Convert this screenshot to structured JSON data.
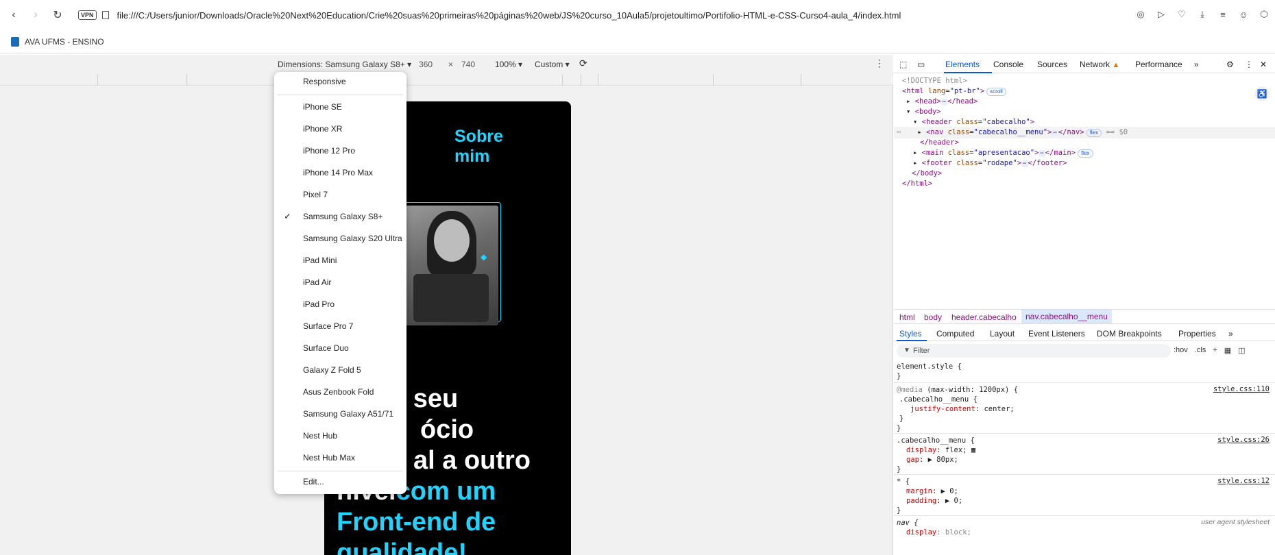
{
  "browser": {
    "url": "file:///C:/Users/junior/Downloads/Oracle%20Next%20Education/Crie%20suas%20primeiras%20páginas%20web/JS%20curso_10Aula5/projetoultimo/Portifolio-HTML-e-CSS-Curso4-aula_4/index.html",
    "vpn_label": "VPN",
    "bookmark_label": "AVA UFMS - ENSINO"
  },
  "device_toolbar": {
    "dimensions_label": "Dimensions: Samsung Galaxy S8+",
    "width": "360",
    "times": "×",
    "height": "740",
    "zoom": "100%",
    "throttle": "Custom"
  },
  "page": {
    "sobre_line1": "Sobre",
    "sobre_line2": "mim",
    "headline_line1": "e seu",
    "headline_line2": "ócio",
    "headline_line3": "al a outro",
    "headline_line4_white": "nível",
    "headline_line4_accent": "com um",
    "headline_line5": "Front-end de",
    "headline_line6": "qualidade!"
  },
  "device_menu": {
    "items": [
      "Responsive",
      "iPhone SE",
      "iPhone XR",
      "iPhone 12 Pro",
      "iPhone 14 Pro Max",
      "Pixel 7",
      "Samsung Galaxy S8+",
      "Samsung Galaxy S20 Ultra",
      "iPad Mini",
      "iPad Air",
      "iPad Pro",
      "Surface Pro 7",
      "Surface Duo",
      "Galaxy Z Fold 5",
      "Asus Zenbook Fold",
      "Samsung Galaxy A51/71",
      "Nest Hub",
      "Nest Hub Max",
      "Edit..."
    ],
    "selected": "Samsung Galaxy S8+",
    "check_glyph": "✓"
  },
  "devtools": {
    "tabs": [
      "Elements",
      "Console",
      "Sources",
      "Network",
      "Performance"
    ],
    "active_tab": "Elements",
    "dom": {
      "doctype": "<!DOCTYPE html>",
      "html_open_tag": "<html",
      "html_lang_attr": "lang",
      "html_lang_val": "\"pt-br\"",
      "scroll_badge": "scroll",
      "head": "<head>",
      "head_close": "</head>",
      "body_open": "<body>",
      "header_tag": "<header",
      "header_class_val": "\"cabecalho\"",
      "nav_tag": "<nav",
      "nav_class_val": "\"cabecalho__menu\"",
      "nav_close": "</nav>",
      "flex_badge": "flex",
      "selected_marker": "== $0",
      "header_close": "</header>",
      "main_tag": "<main",
      "main_class_val": "\"apresentacao\"",
      "main_close": "</main>",
      "footer_tag": "<footer",
      "footer_class_val": "\"rodape\"",
      "footer_close": "</footer>",
      "body_close": "</body>",
      "html_close": "</html>",
      "class_attr": "class",
      "ellipsis": "⋯"
    },
    "breadcrumbs": [
      "html",
      "body",
      "header.cabecalho",
      "nav.cabecalho__menu"
    ],
    "sub_tabs": [
      "Styles",
      "Computed",
      "Layout",
      "Event Listeners",
      "DOM Breakpoints",
      "Properties"
    ],
    "active_sub_tab": "Styles",
    "filter_placeholder": "Filter",
    "filter_tools": [
      ":hov",
      ".cls",
      "+"
    ],
    "styles": {
      "element_style": "element.style {",
      "close_brace": "}",
      "media_rule": "@media",
      "media_query": "(max-width: 1200px) {",
      "media_source": "style.css:110",
      "media_selector": ".cabecalho__menu {",
      "justify_prop": "justify-content",
      "justify_val": ": center;",
      "menu_selector": ".cabecalho__menu {",
      "menu_source": "style.css:26",
      "display_prop": "display",
      "display_val": ": flex;",
      "gap_prop": "gap",
      "gap_val": ": ▶ 80px;",
      "universal_selector": "* {",
      "universal_source": "style.css:12",
      "margin_prop": "margin",
      "margin_val": ": ▶ 0;",
      "padding_prop": "padding",
      "padding_val": ": ▶ 0;",
      "nav_selector": "nav {",
      "nav_source": "user agent stylesheet",
      "nav_display_prop": "display",
      "nav_display_val": ": block;"
    }
  },
  "colors": {
    "accent": "#22d4fd",
    "devtools_blue": "#0b57d0",
    "tag_purple": "#881280"
  }
}
